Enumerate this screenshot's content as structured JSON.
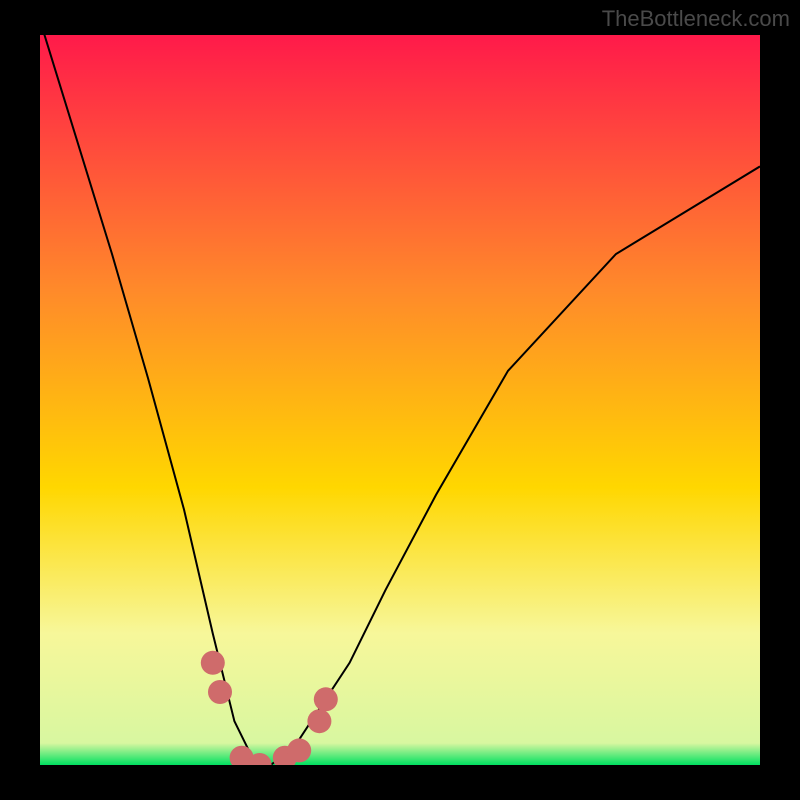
{
  "attribution": "TheBottleneck.com",
  "colors": {
    "frame": "#000000",
    "grad_top": "#ff1a4a",
    "grad_mid1": "#ff6a2a",
    "grad_mid2": "#ffd700",
    "grad_mid3": "#f7f79a",
    "grad_bottom": "#00e060",
    "curve": "#000000",
    "dot": "#cf6b6b"
  },
  "chart_data": {
    "type": "line",
    "title": "",
    "xlabel": "",
    "ylabel": "",
    "xlim": [
      0,
      1
    ],
    "ylim": [
      0,
      1
    ],
    "series": [
      {
        "name": "bottleneck-curve",
        "x": [
          0.0,
          0.05,
          0.1,
          0.15,
          0.2,
          0.24,
          0.27,
          0.3,
          0.32,
          0.35,
          0.43,
          0.48,
          0.55,
          0.65,
          0.8,
          1.0
        ],
        "y": [
          1.02,
          0.86,
          0.7,
          0.53,
          0.35,
          0.18,
          0.06,
          0.0,
          0.0,
          0.02,
          0.14,
          0.24,
          0.37,
          0.54,
          0.7,
          0.82
        ]
      }
    ],
    "dots": [
      {
        "x": 0.24,
        "y": 0.14
      },
      {
        "x": 0.25,
        "y": 0.1
      },
      {
        "x": 0.28,
        "y": 0.01
      },
      {
        "x": 0.305,
        "y": 0.0
      },
      {
        "x": 0.34,
        "y": 0.01
      },
      {
        "x": 0.36,
        "y": 0.02
      },
      {
        "x": 0.388,
        "y": 0.06
      },
      {
        "x": 0.397,
        "y": 0.09
      }
    ]
  }
}
